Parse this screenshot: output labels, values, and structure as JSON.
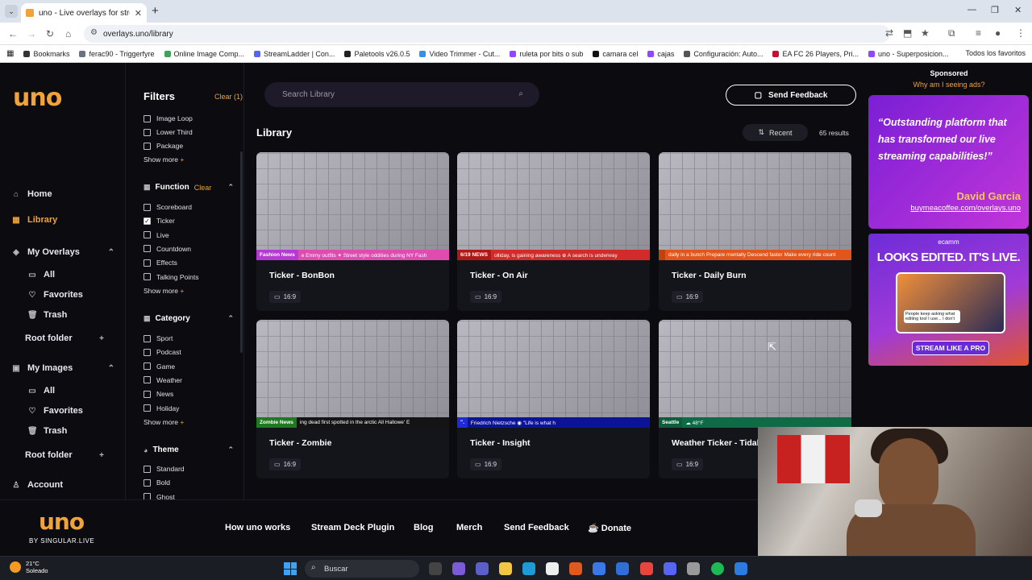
{
  "browser": {
    "tab_title": "uno - Live overlays for streamin",
    "url": "overlays.uno/library",
    "bookmarks": [
      {
        "label": "Bookmarks",
        "icon": "star-icon",
        "color": "#333333"
      },
      {
        "label": "ferac90 - Triggerfyre",
        "icon": "site-icon",
        "color": "#6b7280"
      },
      {
        "label": "Online Image Comp...",
        "icon": "site-icon",
        "color": "#3aa655"
      },
      {
        "label": "StreamLadder | Con...",
        "icon": "site-icon",
        "color": "#5865f2"
      },
      {
        "label": "Paletools v26.0.5",
        "icon": "site-icon",
        "color": "#222222"
      },
      {
        "label": "Video Trimmer - Cut...",
        "icon": "site-icon",
        "color": "#3a8ee6"
      },
      {
        "label": "ruleta por bits o sub",
        "icon": "site-icon",
        "color": "#9146ff"
      },
      {
        "label": "camara cel",
        "icon": "site-icon",
        "color": "#111111"
      },
      {
        "label": "cajas",
        "icon": "site-icon",
        "color": "#9146ff"
      },
      {
        "label": "Configuración: Auto...",
        "icon": "gear-icon",
        "color": "#555555"
      },
      {
        "label": "EA FC 26 Players, Pri...",
        "icon": "site-icon",
        "color": "#c8102e"
      },
      {
        "label": "uno - Superposicion...",
        "icon": "site-icon",
        "color": "#9146ff"
      }
    ],
    "all_bookmarks": "Todos los favoritos"
  },
  "nav": {
    "home": "Home",
    "library": "Library",
    "my_overlays": "My Overlays",
    "overlays_all": "All",
    "overlays_favorites": "Favorites",
    "overlays_trash": "Trash",
    "root_folder_1": "Root folder",
    "my_images": "My Images",
    "images_all": "All",
    "images_favorites": "Favorites",
    "images_trash": "Trash",
    "root_folder_2": "Root folder",
    "account": "Account"
  },
  "filters": {
    "title": "Filters",
    "clear_all": "Clear (1)",
    "type_items": [
      "Image Loop",
      "Lower Third",
      "Package"
    ],
    "show_more": "Show more",
    "function_title": "Function",
    "function_clear": "Clear",
    "function_items": [
      {
        "label": "Scoreboard",
        "checked": false
      },
      {
        "label": "Ticker",
        "checked": true
      },
      {
        "label": "Live",
        "checked": false
      },
      {
        "label": "Countdown",
        "checked": false
      },
      {
        "label": "Effects",
        "checked": false
      },
      {
        "label": "Talking Points",
        "checked": false
      }
    ],
    "category_title": "Category",
    "category_items": [
      "Sport",
      "Podcast",
      "Game",
      "Weather",
      "News",
      "Holiday"
    ],
    "theme_title": "Theme",
    "theme_items": [
      "Standard",
      "Bold",
      "Ghost"
    ]
  },
  "main": {
    "search_placeholder": "Search Library",
    "feedback_button": "Send Feedback",
    "library_title": "Library",
    "sort_label": "Recent",
    "results_count": "65 results",
    "cards": [
      {
        "title": "Ticker - BonBon",
        "ratio": "16:9",
        "tag": "Fashion News",
        "ticker": "e Emmy outfits   ✦  Street style oddities during NY Fash",
        "tag_color": "#b43ad1",
        "bar_color": "#e04bb0"
      },
      {
        "title": "Ticker - On Air",
        "ratio": "16:9",
        "tag": "6/19 NEWS",
        "ticker": "olliday, is gaining awareness   ⊕   A search is underway",
        "tag_color": "#b01717",
        "bar_color": "#d22b2b"
      },
      {
        "title": "Ticker - Daily Burn",
        "ratio": "16:9",
        "tag": "",
        "ticker": "daily in a bunch   Prepare mentally   Descend faster   Make every ride count",
        "tag_color": "#c2410c",
        "bar_color": "#e2561e"
      },
      {
        "title": "Ticker - Zombie",
        "ratio": "16:9",
        "tag": "Zombie News",
        "ticker": "ing dead first spotted in the arctic    All Hallowe' E",
        "tag_color": "#1f7a1f",
        "bar_color": "#141414"
      },
      {
        "title": "Ticker - Insight",
        "ratio": "16:9",
        "tag": "\".",
        "ticker": "Friedrich Nietzsche    ◉    \"Life is what h",
        "tag_color": "#1e2bd6",
        "bar_color": "#0c1396"
      },
      {
        "title": "Weather Ticker - Tidal",
        "ratio": "16:9",
        "tag": "Seattle",
        "ticker": "☁  48°F",
        "tag_color": "#0f5c3a",
        "bar_color": "#0e6b45"
      }
    ]
  },
  "ads": {
    "sponsored": "Sponsored",
    "why": "Why am I seeing ads?",
    "quote": "“Outstanding platform that has transformed our live streaming capabilities!”",
    "author": "David Garcia",
    "link": "buymeacoffee.com/overlays.uno",
    "brand": "ecamm",
    "headline": "LOOKS EDITED. IT'S LIVE.",
    "bubble": "People keep asking what editing tool I use... I don't",
    "cta": "STREAM LIKE A PRO"
  },
  "footer": {
    "logo": "uno",
    "by": "BY SINGULAR.LIVE",
    "links": [
      "How uno works",
      "Stream Deck Plugin",
      "Blog",
      "Merch",
      "Send Feedback",
      "Donate"
    ]
  },
  "taskbar": {
    "temp": "21°C",
    "weather": "Soleado",
    "search": "Buscar"
  }
}
